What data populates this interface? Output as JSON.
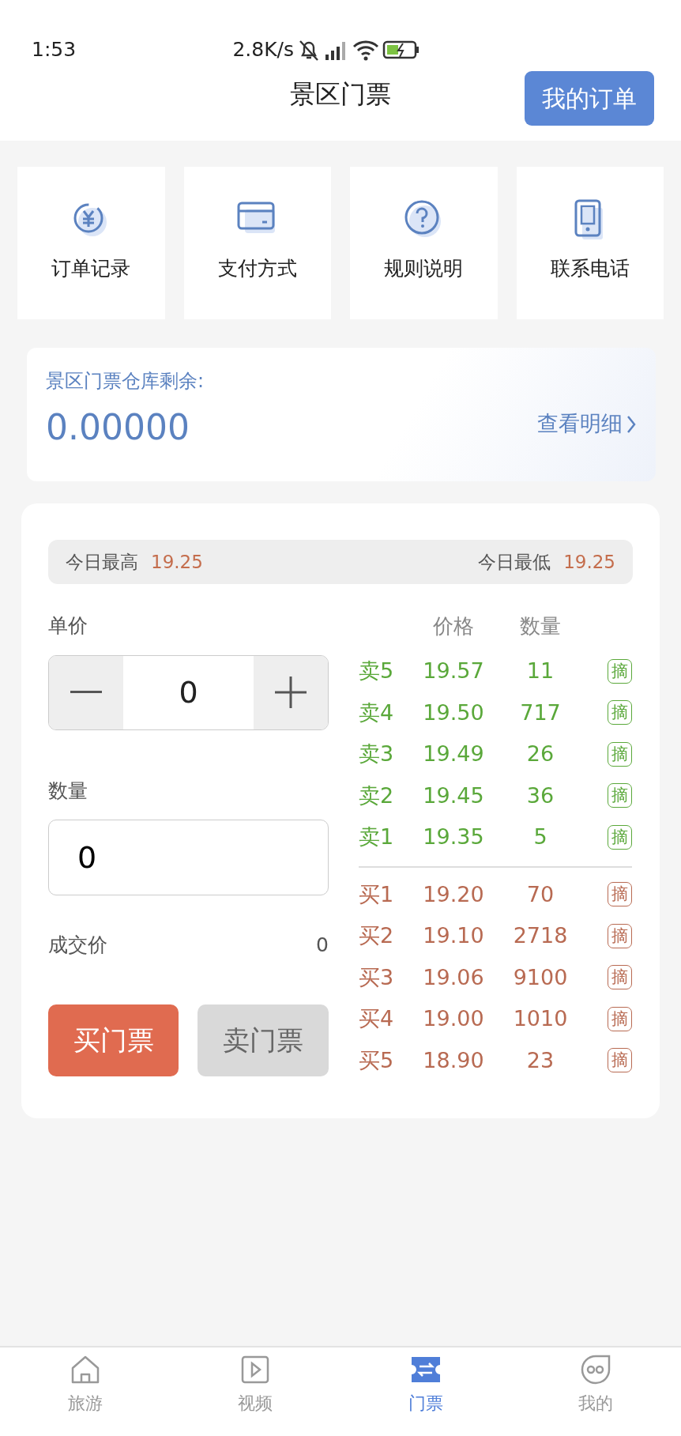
{
  "status_bar": {
    "time": "1:53",
    "net_speed": "2.8K/s"
  },
  "header": {
    "title": "景区门票",
    "button": "我的订单"
  },
  "shortcuts": [
    {
      "kind": "yuan",
      "label": "订单记录"
    },
    {
      "kind": "card",
      "label": "支付方式"
    },
    {
      "kind": "help",
      "label": "规则说明"
    },
    {
      "kind": "phone",
      "label": "联系电话"
    }
  ],
  "warehouse": {
    "label": "景区门票仓库剩余:",
    "value": "0.00000",
    "link": "查看明细"
  },
  "trade": {
    "high_label": "今日最高",
    "high_value": "19.25",
    "low_label": "今日最低",
    "low_value": "19.25",
    "price_label": "单价",
    "price_value": "0",
    "qty_label": "数量",
    "qty_value": "0",
    "deal_label": "成交价",
    "deal_value": "0",
    "buy_button": "买门票",
    "sell_button": "卖门票"
  },
  "order_book": {
    "columns": [
      "价格",
      "数量"
    ],
    "rows": [
      {
        "kind": "sell",
        "label": "卖5",
        "price": "19.57",
        "qty": "11",
        "action": "摘"
      },
      {
        "kind": "sell",
        "label": "卖4",
        "price": "19.50",
        "qty": "717",
        "action": "摘"
      },
      {
        "kind": "sell",
        "label": "卖3",
        "price": "19.49",
        "qty": "26",
        "action": "摘"
      },
      {
        "kind": "sell",
        "label": "卖2",
        "price": "19.45",
        "qty": "36",
        "action": "摘"
      },
      {
        "kind": "sell",
        "label": "卖1",
        "price": "19.35",
        "qty": "5",
        "action": "摘"
      },
      {
        "kind": "buy",
        "label": "买1",
        "price": "19.20",
        "qty": "70",
        "action": "摘"
      },
      {
        "kind": "buy",
        "label": "买2",
        "price": "19.10",
        "qty": "2718",
        "action": "摘"
      },
      {
        "kind": "buy",
        "label": "买3",
        "price": "19.06",
        "qty": "9100",
        "action": "摘"
      },
      {
        "kind": "buy",
        "label": "买4",
        "price": "19.00",
        "qty": "1010",
        "action": "摘"
      },
      {
        "kind": "buy",
        "label": "买5",
        "price": "18.90",
        "qty": "23",
        "action": "摘"
      }
    ]
  },
  "tab_bar": [
    {
      "kind": "home",
      "label": "旅游",
      "selected": false
    },
    {
      "kind": "video",
      "label": "视频",
      "selected": false
    },
    {
      "kind": "ticket",
      "label": "门票",
      "selected": true
    },
    {
      "kind": "face",
      "label": "我的",
      "selected": false
    }
  ]
}
